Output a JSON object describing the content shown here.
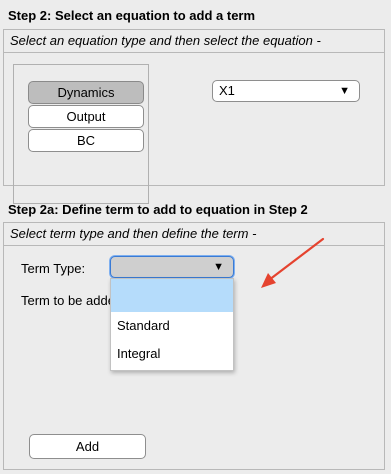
{
  "step2": {
    "heading": "Step 2: Select an equation to add a term",
    "subtitle": "Select an equation type and then select the equation -",
    "buttons": [
      {
        "label": "Dynamics",
        "selected": true
      },
      {
        "label": "Output",
        "selected": false
      },
      {
        "label": "BC",
        "selected": false
      }
    ],
    "equation_select": {
      "value": "X1"
    }
  },
  "step2a": {
    "heading": "Step 2a: Define term to add to equation in Step 2",
    "subtitle": "Select term type and then define the term -",
    "term_type_label": "Term Type:",
    "term_to_be_added_label": "Term to be adde",
    "term_type_select": {
      "value": ""
    },
    "dropdown_options": [
      "",
      "Standard",
      "Integral"
    ],
    "add_label": "Add"
  },
  "colors": {
    "background": "#ececec",
    "selected_button": "#bdbdbd",
    "highlight_option": "#b5dcfb",
    "arrow": "#e5432f",
    "focus_border": "#3a7bd5"
  },
  "icons": [
    "chevron-down-icon",
    "annotation-arrow"
  ]
}
